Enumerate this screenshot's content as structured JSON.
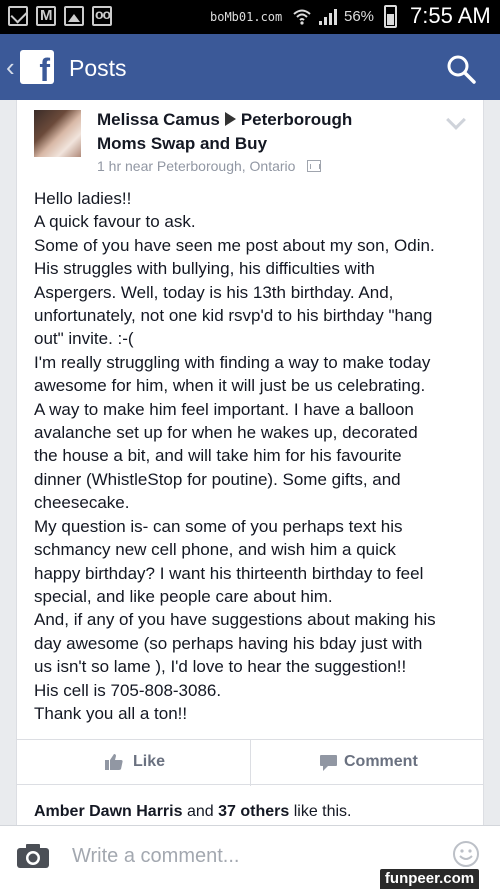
{
  "status_bar": {
    "carrier": "boMb01.com",
    "battery_percent": "56%",
    "battery_level": 0.56,
    "time": "7:55 AM",
    "icons": [
      "envelope-icon",
      "gmail-icon",
      "image-icon",
      "voicemail-icon",
      "wifi-icon",
      "signal-icon",
      "battery-icon"
    ]
  },
  "header": {
    "title": "Posts",
    "logo": "f",
    "icons": [
      "back-chevron-icon",
      "facebook-logo",
      "search-icon"
    ],
    "color": "#3b5998"
  },
  "post": {
    "author": "Melissa Camus",
    "group_line1": "Peterborough",
    "group_line2": "Moms Swap and Buy",
    "meta": "1 hr near Peterborough, Ontario",
    "lines": [
      "Hello ladies!!",
      "A quick favour to ask.",
      "Some of you have seen me post about my son, Odin.",
      "His struggles with bullying, his difficulties with",
      "Aspergers. Well, today is his 13th birthday. And,",
      "unfortunately, not one kid rsvp'd to his birthday \"hang",
      "out\" invite. :-(",
      "I'm really struggling with finding a way to make today",
      "awesome for him, when it will just be us celebrating.",
      "A way to make him feel important. I have a balloon",
      "avalanche set up for when he wakes up, decorated",
      "the house a bit, and will take him for his favourite",
      "dinner (WhistleStop for poutine). Some gifts, and",
      "cheesecake.",
      "My question is- can some of you perhaps text his",
      "schmancy new cell phone, and wish him a quick",
      "happy birthday? I want his thirteenth birthday to feel",
      "special, and like people care about him.",
      "And, if any of you have suggestions about making his",
      "day awesome (so perhaps having his bday just with",
      "us isn't so lame ), I'd love to hear the suggestion!!",
      "His cell is 705-808-3086.",
      "Thank you all a ton!!"
    ],
    "like_label": "Like",
    "comment_label": "Comment",
    "likes_name": "Amber Dawn Harris",
    "likes_and": "and",
    "likes_others": "37 others",
    "likes_suffix": "like this."
  },
  "comment_bar": {
    "placeholder": "Write a comment...",
    "icons": [
      "camera-icon",
      "smiley-icon"
    ]
  },
  "watermark": "funpeer.com"
}
